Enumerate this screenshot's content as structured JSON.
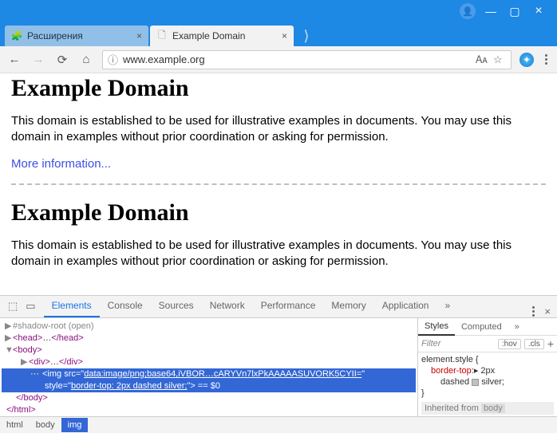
{
  "window": {
    "user": "👤"
  },
  "tabs": [
    {
      "favicon": "🧩",
      "title": "Расширения"
    },
    {
      "favicon": "🗋",
      "title": "Example Domain"
    }
  ],
  "address": {
    "url": "www.example.org"
  },
  "page": {
    "h1": "Example Domain",
    "p": "This domain is established to be used for illustrative examples in documents. You may use this domain in examples without prior coordination or asking for permission.",
    "link": "More information..."
  },
  "devtools": {
    "tabs": [
      "Elements",
      "Console",
      "Sources",
      "Network",
      "Performance",
      "Memory",
      "Application"
    ],
    "dom": {
      "shadow": "#shadow-root (open)",
      "head1": "<head>",
      "head2": "</head>",
      "headdots": "…",
      "body1": "<body>",
      "body2": "</body>",
      "div1": "<div>",
      "div2": "</div>",
      "divdots": "…",
      "img_pre": "<img src=\"",
      "img_data": "data:image/png;base64,iVBOR…cARYVn7lxPkAAAAASUVORK5CYII=",
      "img_mid": "\"",
      "img_style_attr": "style",
      "img_style_val": "border-top: 2px dashed silver;",
      "img_end": "> == $0",
      "html2": "</html>"
    },
    "styles": {
      "tabs": [
        "Styles",
        "Computed"
      ],
      "filter": "Filter",
      "hov": ":hov",
      "cls": ".cls",
      "rule_sel": "element.style {",
      "prop": "border-top",
      "val1": "2px",
      "val2": "dashed",
      "val3": "silver",
      "close": "}",
      "inherit": "Inherited from",
      "inherit_el": "body"
    },
    "crumbs": [
      "html",
      "body",
      "img"
    ]
  }
}
